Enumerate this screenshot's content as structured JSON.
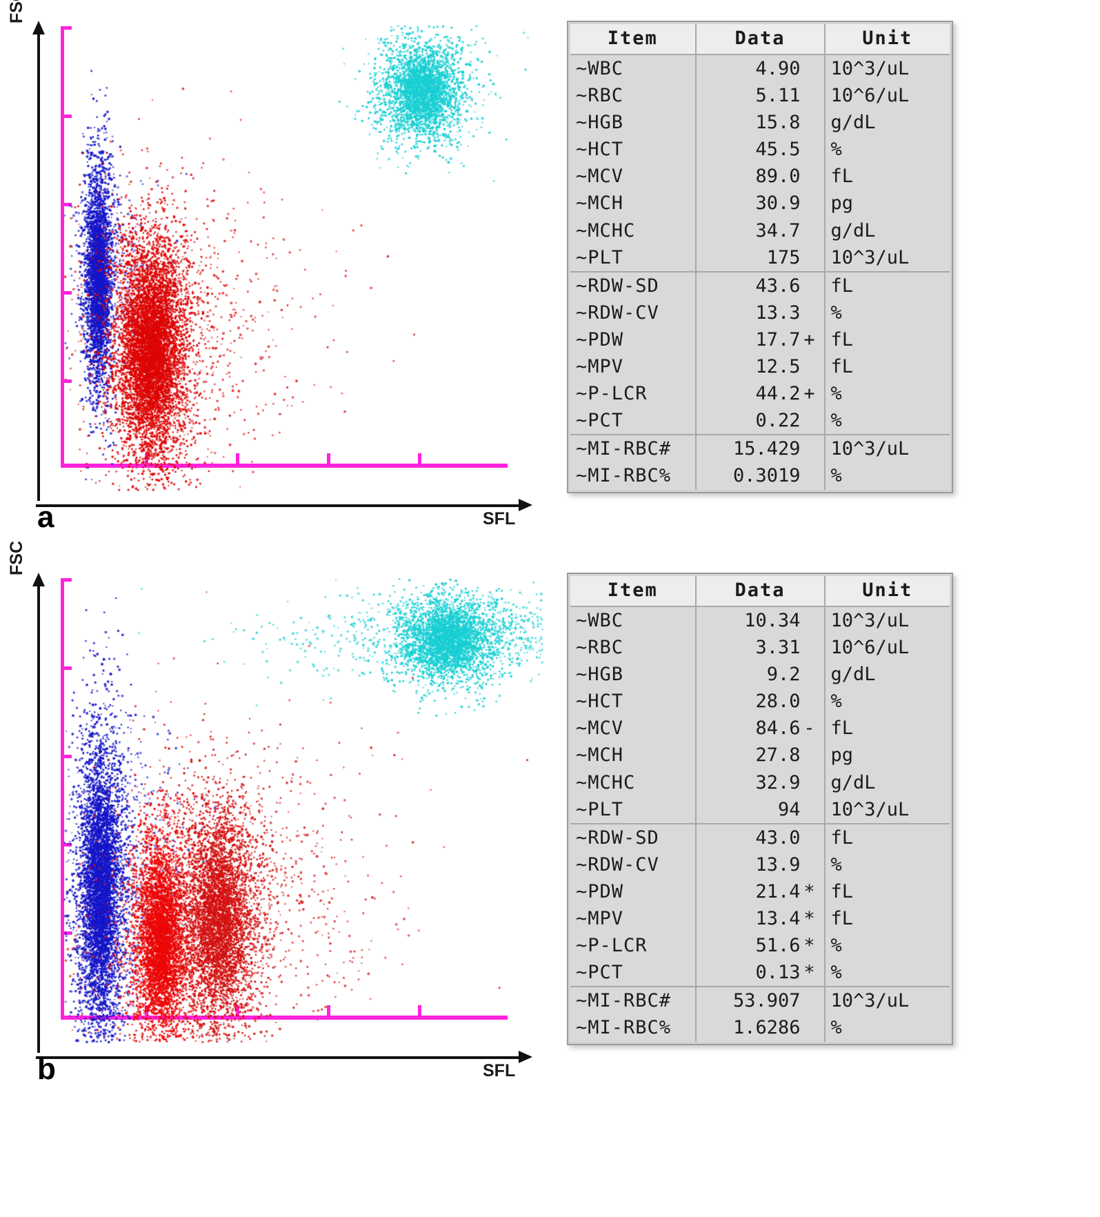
{
  "panels": [
    {
      "letter": "a",
      "x_axis_label": "SFL",
      "y_axis_label": "FSC",
      "frame_color": "#ff22dd"
    },
    {
      "letter": "b",
      "x_axis_label": "SFL",
      "y_axis_label": "FSC",
      "frame_color": "#ff22dd"
    }
  ],
  "tables": [
    {
      "columns": [
        "Item",
        "Data",
        "Unit"
      ],
      "rows": [
        {
          "item": "~WBC",
          "data": "4.90",
          "flag": "",
          "unit": "10^3/uL",
          "group_end": false
        },
        {
          "item": "~RBC",
          "data": "5.11",
          "flag": "",
          "unit": "10^6/uL",
          "group_end": false
        },
        {
          "item": "~HGB",
          "data": "15.8",
          "flag": "",
          "unit": "g/dL",
          "group_end": false
        },
        {
          "item": "~HCT",
          "data": "45.5",
          "flag": "",
          "unit": "%",
          "group_end": false
        },
        {
          "item": "~MCV",
          "data": "89.0",
          "flag": "",
          "unit": "fL",
          "group_end": false
        },
        {
          "item": "~MCH",
          "data": "30.9",
          "flag": "",
          "unit": "pg",
          "group_end": false
        },
        {
          "item": "~MCHC",
          "data": "34.7",
          "flag": "",
          "unit": "g/dL",
          "group_end": false
        },
        {
          "item": "~PLT",
          "data": "175",
          "flag": "",
          "unit": "10^3/uL",
          "group_end": true
        },
        {
          "item": "~RDW-SD",
          "data": "43.6",
          "flag": "",
          "unit": "fL",
          "group_end": false
        },
        {
          "item": "~RDW-CV",
          "data": "13.3",
          "flag": "",
          "unit": "%",
          "group_end": false
        },
        {
          "item": "~PDW",
          "data": "17.7",
          "flag": "+",
          "unit": "fL",
          "group_end": false
        },
        {
          "item": "~MPV",
          "data": "12.5",
          "flag": "",
          "unit": "fL",
          "group_end": false
        },
        {
          "item": "~P-LCR",
          "data": "44.2",
          "flag": "+",
          "unit": "%",
          "group_end": false
        },
        {
          "item": "~PCT",
          "data": "0.22",
          "flag": "",
          "unit": "%",
          "group_end": true
        },
        {
          "item": "~MI-RBC#",
          "data": "15.429",
          "flag": "",
          "unit": "10^3/uL",
          "group_end": false
        },
        {
          "item": "~MI-RBC%",
          "data": "0.3019",
          "flag": "",
          "unit": "%",
          "group_end": false
        }
      ]
    },
    {
      "columns": [
        "Item",
        "Data",
        "Unit"
      ],
      "rows": [
        {
          "item": "~WBC",
          "data": "10.34",
          "flag": "",
          "unit": "10^3/uL",
          "group_end": false
        },
        {
          "item": "~RBC",
          "data": "3.31",
          "flag": "",
          "unit": "10^6/uL",
          "group_end": false
        },
        {
          "item": "~HGB",
          "data": "9.2",
          "flag": "",
          "unit": "g/dL",
          "group_end": false
        },
        {
          "item": "~HCT",
          "data": "28.0",
          "flag": "",
          "unit": "%",
          "group_end": false
        },
        {
          "item": "~MCV",
          "data": "84.6",
          "flag": "-",
          "unit": "fL",
          "group_end": false
        },
        {
          "item": "~MCH",
          "data": "27.8",
          "flag": "",
          "unit": "pg",
          "group_end": false
        },
        {
          "item": "~MCHC",
          "data": "32.9",
          "flag": "",
          "unit": "g/dL",
          "group_end": false
        },
        {
          "item": "~PLT",
          "data": "94",
          "flag": "",
          "unit": "10^3/uL",
          "group_end": true
        },
        {
          "item": "~RDW-SD",
          "data": "43.0",
          "flag": "",
          "unit": "fL",
          "group_end": false
        },
        {
          "item": "~RDW-CV",
          "data": "13.9",
          "flag": "",
          "unit": "%",
          "group_end": false
        },
        {
          "item": "~PDW",
          "data": "21.4",
          "flag": "*",
          "unit": "fL",
          "group_end": false
        },
        {
          "item": "~MPV",
          "data": "13.4",
          "flag": "*",
          "unit": "fL",
          "group_end": false
        },
        {
          "item": "~P-LCR",
          "data": "51.6",
          "flag": "*",
          "unit": "%",
          "group_end": false
        },
        {
          "item": "~PCT",
          "data": "0.13",
          "flag": "*",
          "unit": "%",
          "group_end": true
        },
        {
          "item": "~MI-RBC#",
          "data": "53.907",
          "flag": "",
          "unit": "10^3/uL",
          "group_end": false
        },
        {
          "item": "~MI-RBC%",
          "data": "1.6286",
          "flag": "",
          "unit": "%",
          "group_end": false
        }
      ]
    }
  ],
  "chart_data": [
    {
      "type": "scatter",
      "panel": "a",
      "xlabel": "SFL",
      "ylabel": "FSC",
      "grid": false,
      "legend": "none",
      "xlim": [
        0,
        1
      ],
      "ylim": [
        0,
        1
      ],
      "x_ticks": [
        0.18,
        0.37,
        0.56,
        0.75
      ],
      "y_ticks": [
        0.0,
        0.2,
        0.4,
        0.6,
        0.8
      ],
      "series": [
        {
          "name": "blue-population",
          "color": "#1515c8",
          "n": 2600,
          "cx": 0.075,
          "cy": 0.455,
          "sx": 0.016,
          "sy": 0.135,
          "tail_x": 0.055,
          "tail_y": 0.1,
          "tail_frac": 0.14
        },
        {
          "name": "red-population",
          "color": "#dd0505",
          "n": 5200,
          "cx": 0.185,
          "cy": 0.305,
          "sx": 0.042,
          "sy": 0.135,
          "tail_x": 0.13,
          "tail_y": 0.16,
          "tail_frac": 0.16
        },
        {
          "name": "cyan-population",
          "color": "#19cfd3",
          "n": 2100,
          "cx": 0.745,
          "cy": 0.855,
          "sx": 0.048,
          "sy": 0.058,
          "tail_x": 0.07,
          "tail_y": 0.09,
          "tail_frac": 0.08
        }
      ]
    },
    {
      "type": "scatter",
      "panel": "b",
      "xlabel": "SFL",
      "ylabel": "FSC",
      "grid": false,
      "legend": "none",
      "xlim": [
        0,
        1
      ],
      "ylim": [
        0,
        1
      ],
      "x_ticks": [
        0.18,
        0.37,
        0.56,
        0.75
      ],
      "y_ticks": [
        0.0,
        0.2,
        0.4,
        0.6,
        0.8
      ],
      "series": [
        {
          "name": "blue-population",
          "color": "#1515c8",
          "n": 4200,
          "cx": 0.08,
          "cy": 0.33,
          "sx": 0.026,
          "sy": 0.18,
          "tail_x": 0.075,
          "tail_y": 0.16,
          "tail_frac": 0.18
        },
        {
          "name": "red-population-1",
          "color": "#ee0606",
          "n": 3400,
          "cx": 0.205,
          "cy": 0.22,
          "sx": 0.032,
          "sy": 0.125,
          "tail_x": 0.09,
          "tail_y": 0.14,
          "tail_frac": 0.16
        },
        {
          "name": "red-population-2",
          "color": "#d31010",
          "n": 3600,
          "cx": 0.325,
          "cy": 0.265,
          "sx": 0.048,
          "sy": 0.14,
          "tail_x": 0.15,
          "tail_y": 0.17,
          "tail_frac": 0.22
        },
        {
          "name": "cyan-population",
          "color": "#19cfd3",
          "n": 2800,
          "cx": 0.8,
          "cy": 0.865,
          "sx": 0.06,
          "sy": 0.052,
          "tail_x": 0.2,
          "tail_y": 0.045,
          "tail_frac": 0.35
        }
      ]
    }
  ]
}
